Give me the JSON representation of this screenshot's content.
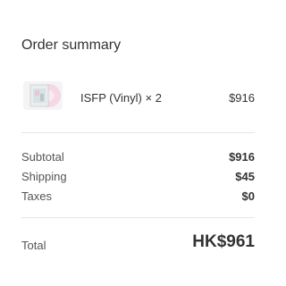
{
  "summary": {
    "title": "Order summary"
  },
  "item": {
    "name": "ISFP (Vinyl) × 2",
    "price": "$916",
    "thumbnail_icon": "vinyl-record-thumbnail-icon"
  },
  "totals": {
    "subtotal_label": "Subtotal",
    "subtotal_value": "$916",
    "shipping_label": "Shipping",
    "shipping_value": "$45",
    "taxes_label": "Taxes",
    "taxes_value": "$0",
    "total_label": "Total",
    "total_value": "HK$961"
  },
  "colors": {
    "text_primary": "#333333",
    "text_secondary": "#545454",
    "divider": "#e6e6e6",
    "thumb_pink": "#f3c6d8"
  }
}
